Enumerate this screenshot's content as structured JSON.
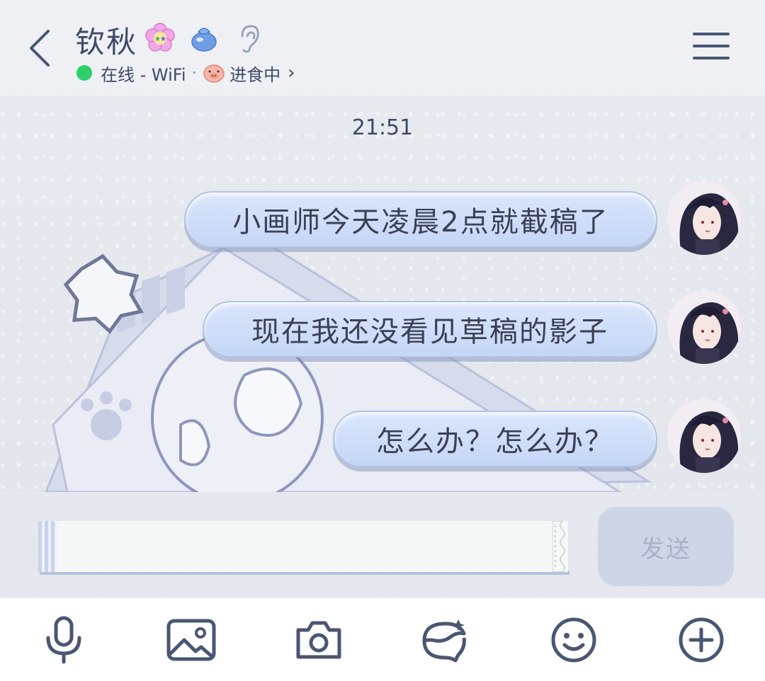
{
  "header": {
    "title": "钦秋",
    "status_text": "在线 - WiFi",
    "separator": "·",
    "activity": "进食中",
    "icons": [
      "back-icon",
      "flower-badge-icon",
      "money-bag-icon",
      "ear-icon",
      "pig-icon",
      "chevron-right-icon",
      "menu-icon"
    ]
  },
  "chat": {
    "timestamp": "21:51",
    "messages": [
      {
        "text": "小画师今天凌晨2点就截稿了",
        "sender": "self"
      },
      {
        "text": "现在我还没看见草稿的影子",
        "sender": "self"
      },
      {
        "text": "怎么办？怎么办？",
        "sender": "self"
      }
    ]
  },
  "composer": {
    "input_value": "",
    "send_label": "发送"
  },
  "toolbar": {
    "items": [
      "microphone-icon",
      "image-icon",
      "camera-icon",
      "sticker-icon",
      "emoji-icon",
      "add-icon"
    ]
  },
  "colors": {
    "accent": "#3e4a66",
    "bubble": "#c9d8f6",
    "online": "#2fcf6a"
  }
}
